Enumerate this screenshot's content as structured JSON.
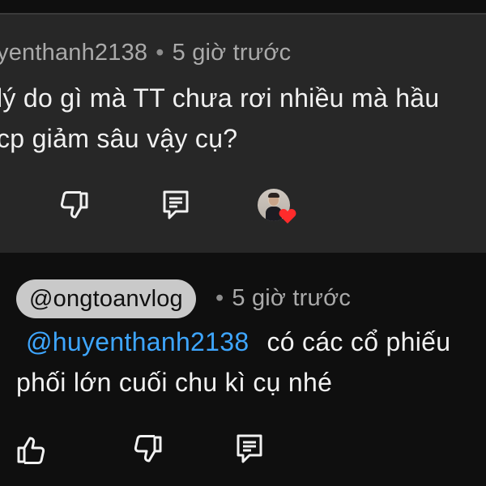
{
  "top_comment": {
    "author": "yenthanh2138",
    "time": "5 giờ trước",
    "line1": "lý do gì mà TT chưa rơi nhiều mà hầu",
    "line2": "cp giảm sâu vậy cụ?",
    "actions": {
      "dislike_icon": "thumbs-down-icon",
      "reply_icon": "reply-icon",
      "creator_heart": "creator-heart-badge"
    }
  },
  "reply": {
    "author": "@ongtoanvlog",
    "time": "5 giờ trước",
    "mention": "@huyenthanh2138",
    "line1_rest": "có các cổ phiếu",
    "line2": "phối lớn cuối chu kì cụ nhé",
    "actions": {
      "like_icon": "thumbs-up-icon",
      "dislike_icon": "thumbs-down-icon",
      "reply_icon": "reply-icon"
    }
  },
  "colors": {
    "background": "#0f0f0f",
    "highlight_card": "#272727",
    "author_chip": "#c9c9c9",
    "mention_link": "#3ea6ff",
    "heart": "#ff2b2b"
  }
}
